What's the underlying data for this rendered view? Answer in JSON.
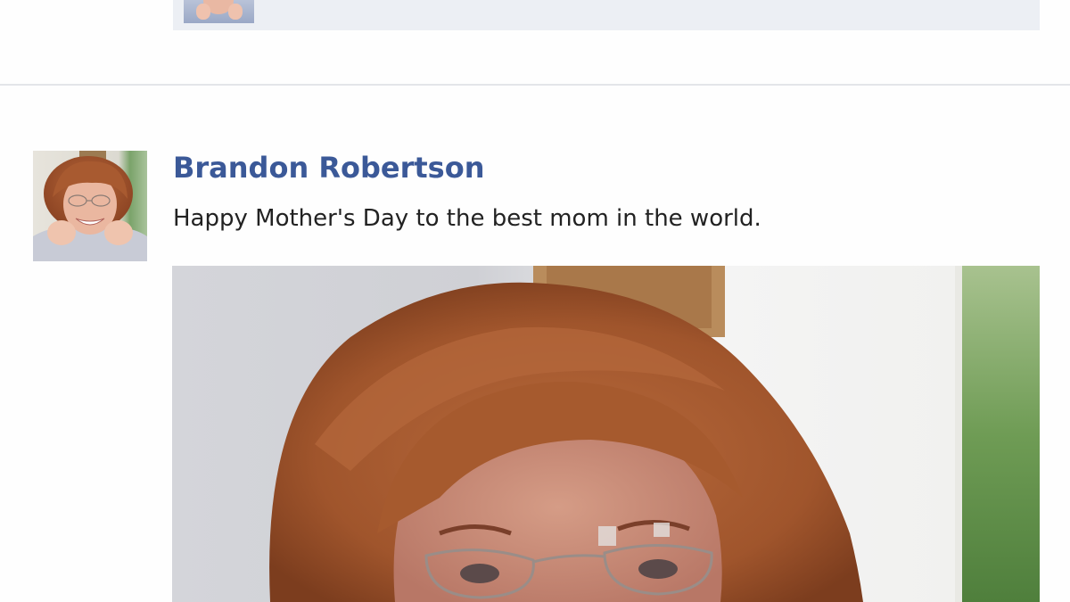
{
  "feed": {
    "previous_post": {
      "attachment_thumbnail": "photo-thumbnail"
    },
    "post": {
      "author_name": "Brandon Robertson",
      "message": "Happy Mother's Day to the best mom in the world.",
      "avatar": "profile-picture",
      "photo": "attached-photo"
    }
  },
  "colors": {
    "author_link": "#3b5998",
    "message_text": "#222222",
    "divider": "#e3e5e9",
    "attachment_bg": "#eceff4"
  }
}
